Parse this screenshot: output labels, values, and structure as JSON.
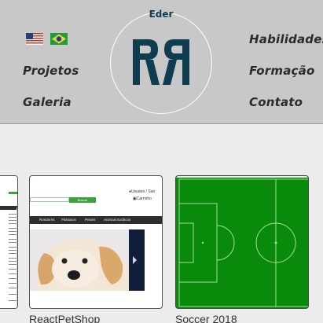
{
  "header": {
    "logo_name": "Eder",
    "nav": {
      "projetos": "Projetos",
      "galeria": "Galeria",
      "habilidades": "Habilidades",
      "formacao": "Formação",
      "contato": "Contato"
    },
    "flags": [
      "us-flag-icon",
      "brazil-flag-icon"
    ]
  },
  "projects": [
    {
      "title": "ReactPetShop",
      "preview": {
        "button_label": "Buscar",
        "user_label": "Usuário / Sair",
        "cart_label": "Carrinho",
        "menu": [
          "Roedores",
          "Pássaros",
          "Peixes",
          "Animais Exóticos"
        ]
      }
    },
    {
      "title": "Soccer 2018"
    }
  ],
  "colors": {
    "header_bg": "#c8c8c8",
    "logo": "#0f3d4f",
    "pitch": "#0a8a0a"
  }
}
